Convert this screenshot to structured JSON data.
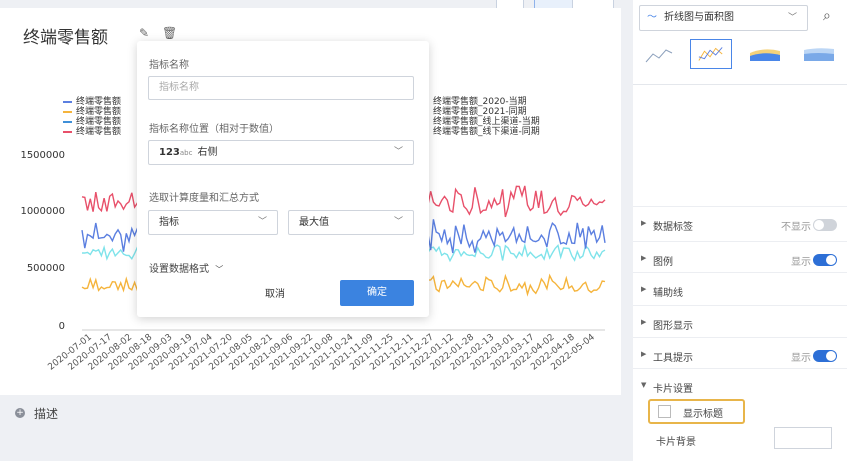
{
  "card": {
    "title": "终端零售额",
    "edit_icon": "edit-icon",
    "delete_icon": "trash-icon",
    "legend_left": [
      {
        "label": "终端零售额",
        "color": "#5b7fe0"
      },
      {
        "label": "终端零售额",
        "color": "#f5b43c"
      },
      {
        "label": "终端零售额",
        "color": "#3f8fd8"
      },
      {
        "label": "终端零售额",
        "color": "#e8506a"
      }
    ],
    "legend_right": [
      {
        "label": "终端零售额_2020-当期",
        "color": "#7ec8e3"
      },
      {
        "label": "终端零售额_2021-同期",
        "color": "#f5b43c"
      },
      {
        "label": "终端零售额_线上渠道-当期",
        "color": "#5b7fe0"
      },
      {
        "label": "终端零售额_线下渠道-同期",
        "color": "#e8506a"
      }
    ]
  },
  "chart_data": {
    "type": "line",
    "y_ticks": [
      "1500000",
      "1000000",
      "500000",
      "0"
    ],
    "ylim": [
      0,
      1700000
    ],
    "x_ticks": [
      "2020-07-01",
      "2020-07-17",
      "2020-08-02",
      "2020-08-18",
      "2020-09-03",
      "2020-09-19",
      "2021-07-04",
      "2021-07-20",
      "2021-08-05",
      "2021-08-21",
      "2021-09-06",
      "2021-09-22",
      "2021-10-08",
      "2021-10-24",
      "2021-11-09",
      "2021-11-25",
      "2021-12-11",
      "2021-12-27",
      "2022-01-12",
      "2022-01-28",
      "2022-02-13",
      "2022-03-01",
      "2022-03-17",
      "2022-04-02",
      "2022-04-18",
      "2022-05-04"
    ],
    "series": [
      {
        "name": "终端零售额_2020-当期",
        "color": "#7ee3ea",
        "base": 650000,
        "amp": 50000,
        "seed": 3
      },
      {
        "name": "终端零售额_2021-同期",
        "color": "#f5b43c",
        "base": 380000,
        "amp": 55000,
        "seed": 7
      },
      {
        "name": "终端零售额_线上渠道-当期",
        "color": "#5b7fe0",
        "base": 790000,
        "amp": 90000,
        "seed": 11
      },
      {
        "name": "终端零售额_线下渠道-同期",
        "color": "#e8506a",
        "base": 1090000,
        "amp": 95000,
        "seed": 17
      }
    ]
  },
  "description": {
    "label": "描述",
    "icon": "plus-circle-icon"
  },
  "popup": {
    "name_label": "指标名称",
    "name_placeholder": "指标名称",
    "position_label": "指标名称位置（相对于数值）",
    "position_badge": "123",
    "position_badge_small": "abc",
    "position_value": "右侧",
    "calc_label": "选取计算度量和汇总方式",
    "measure_value": "指标",
    "agg_value": "最大值",
    "format_label": "设置数据格式",
    "cancel": "取消",
    "ok": "确定"
  },
  "panel": {
    "chart_type": "折线图与面积图",
    "chart_type_icon": "line-chart-icon",
    "search_icon": "search-icon",
    "rows": [
      {
        "label": "数据标签",
        "value": "不显示",
        "toggle": "off",
        "arrow": "▶"
      },
      {
        "label": "图例",
        "value": "显示",
        "toggle": "on",
        "arrow": "▶"
      },
      {
        "label": "辅助线",
        "value": "",
        "toggle": "",
        "arrow": "▶"
      },
      {
        "label": "图形显示",
        "value": "",
        "toggle": "",
        "arrow": "▶"
      },
      {
        "label": "工具提示",
        "value": "显示",
        "toggle": "on",
        "arrow": "▶"
      },
      {
        "label": "卡片设置",
        "value": "",
        "toggle": "",
        "arrow": "▼"
      }
    ],
    "show_title": "显示标题",
    "card_bg": "卡片背景",
    "colors": {
      "accent": "#2d6fd6",
      "highlight": "#e8b54a"
    }
  }
}
